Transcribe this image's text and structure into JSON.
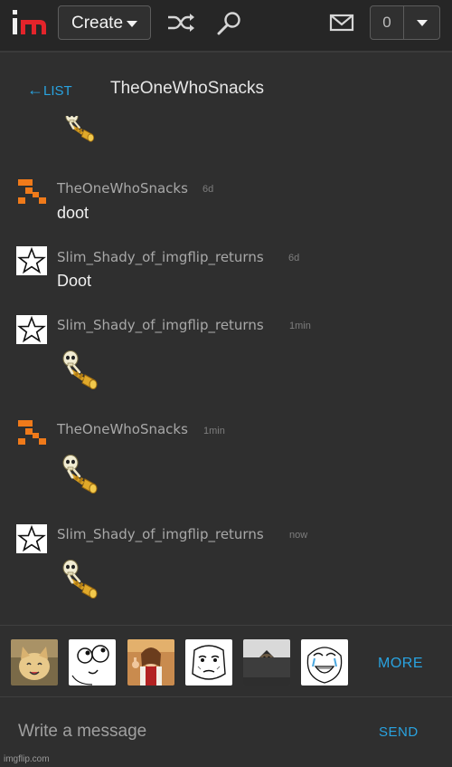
{
  "topbar": {
    "create_label": "Create",
    "notification_count": "0",
    "icons": [
      "imgflip-logo",
      "shuffle-icon",
      "search-icon",
      "mail-icon",
      "chevron-down-icon"
    ]
  },
  "conversation": {
    "back_label": "LIST",
    "title": "TheOneWhoSnacks"
  },
  "messages": [
    {
      "author": "TheOneWhoSnacks",
      "time": "6d",
      "text": "doot",
      "avatar": "orange-arrow-avatar"
    },
    {
      "author": "Slim_Shady_of_imgflip_returns",
      "time": "6d",
      "text": "Doot",
      "avatar": "star-avatar"
    },
    {
      "author": "Slim_Shady_of_imgflip_returns",
      "time": "1min",
      "sticker": "skeleton-trumpet",
      "avatar": "star-avatar"
    },
    {
      "author": "TheOneWhoSnacks",
      "time": "1min",
      "sticker": "skeleton-trumpet",
      "avatar": "orange-arrow-avatar"
    },
    {
      "author": "Slim_Shady_of_imgflip_returns",
      "time": "now",
      "sticker": "skeleton-trumpet",
      "avatar": "star-avatar"
    }
  ],
  "tray": {
    "thumbnails": [
      "happy-cat",
      "derp-face",
      "buddy-christ",
      "okay-face",
      "ceiling-cat",
      "happy-tears-face"
    ],
    "more_label": "MORE"
  },
  "composer": {
    "placeholder": "Write a message",
    "send_label": "SEND"
  },
  "watermark": "imgflip.com",
  "colors": {
    "background": "#2f2f2f",
    "topbar": "#262626",
    "accent_blue": "#29a3e0",
    "logo_red": "#e3242b"
  }
}
